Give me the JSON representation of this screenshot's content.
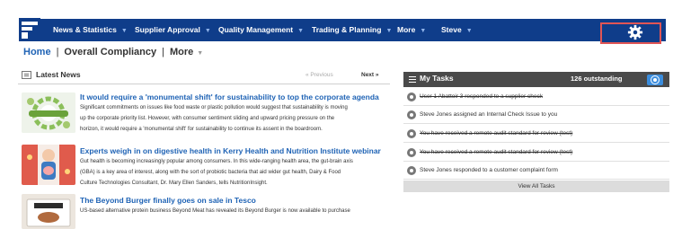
{
  "nav": {
    "items": [
      {
        "label": "News & Statistics"
      },
      {
        "label": "Supplier Approval"
      },
      {
        "label": "Quality Management"
      },
      {
        "label": "Trading & Planning"
      },
      {
        "label": "More"
      },
      {
        "label": "Steve"
      }
    ],
    "colors": {
      "bar": "#0f3d8a",
      "highlight_border": "#e05555"
    }
  },
  "breadcrumb": {
    "home": "Home",
    "current": "Overall Compliancy",
    "more": "More"
  },
  "news": {
    "title": "Latest News",
    "prev": "« Previous",
    "next": "Next »",
    "articles": [
      {
        "title": "It would require a 'monumental shift' for sustainability to top the corporate agenda",
        "lines": [
          "Significant commitments on issues like food waste or plastic pollution would suggest that sustainability is moving",
          "up the corporate priority list. However, with consumer sentiment sliding and upward pricing pressure on the",
          "horizon, it would require a 'monumental shift' for sustainability to continue its assent in the boardroom."
        ],
        "thumb_label": "SUSTAINABILITY"
      },
      {
        "title": "Experts weigh in on digestive health in Kerry Health and Nutrition Institute webinar",
        "lines": [
          "Gut health is becoming increasingly popular among consumers. In this wide-ranging health area, the gut-brain axis",
          "(GBA) is a key area of interest, along with the sort of probiotic bacteria that aid wider gut health, Dairy & Food",
          "Culture Technologies Consultant, Dr. Mary Ellen Sanders, tells NutritionInsight."
        ]
      },
      {
        "title": "The Beyond Burger finally goes on sale in Tesco",
        "lines": [
          "US-based alternative protein business Beyond Meat has revealed its Beyond Burger is now available to purchase"
        ]
      }
    ]
  },
  "tasks": {
    "title": "My Tasks",
    "count": "126 outstanding",
    "items": [
      {
        "text": "User 1 Abattoir 3 responded to a supplier check",
        "done": true
      },
      {
        "text": "Steve Jones assigned an Internal Check Issue to you",
        "done": false
      },
      {
        "text": "You have received a remote audit standard for review (test)",
        "done": true
      },
      {
        "text": "You have received a remote audit standard for review (test)",
        "done": true
      },
      {
        "text": "Steve Jones responded to a customer complaint form",
        "done": false
      }
    ],
    "view_all": "View All Tasks"
  }
}
